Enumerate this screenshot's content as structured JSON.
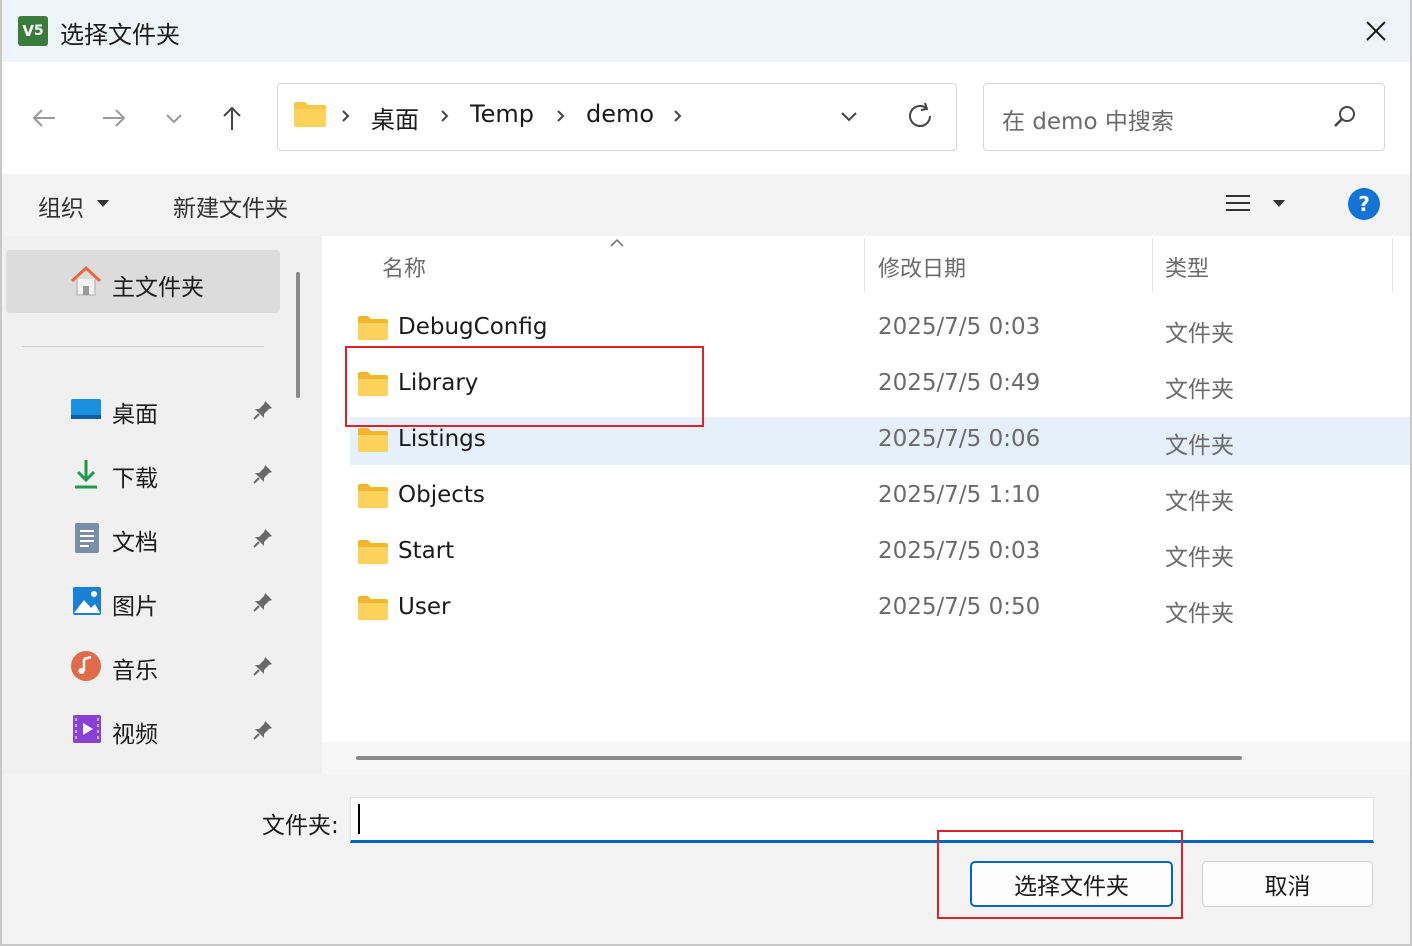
{
  "window": {
    "title": "选择文件夹",
    "app_icon_letter": "V",
    "app_icon_sub": "5"
  },
  "breadcrumb": [
    "桌面",
    "Temp",
    "demo"
  ],
  "search": {
    "placeholder": "在 demo 中搜索"
  },
  "toolbar": {
    "organize": "组织",
    "new_folder": "新建文件夹"
  },
  "sidebar": {
    "home": "主文件夹",
    "items": [
      {
        "label": "桌面",
        "icon": "desktop-icon"
      },
      {
        "label": "下载",
        "icon": "download-icon"
      },
      {
        "label": "文档",
        "icon": "document-icon"
      },
      {
        "label": "图片",
        "icon": "picture-icon"
      },
      {
        "label": "音乐",
        "icon": "music-icon"
      },
      {
        "label": "视频",
        "icon": "video-icon"
      }
    ]
  },
  "columns": {
    "name": "名称",
    "date": "修改日期",
    "type": "类型"
  },
  "files": [
    {
      "name": "DebugConfig",
      "date": "2025/7/5 0:03",
      "type": "文件夹"
    },
    {
      "name": "Library",
      "date": "2025/7/5 0:49",
      "type": "文件夹"
    },
    {
      "name": "Listings",
      "date": "2025/7/5 0:06",
      "type": "文件夹"
    },
    {
      "name": "Objects",
      "date": "2025/7/5 1:10",
      "type": "文件夹"
    },
    {
      "name": "Start",
      "date": "2025/7/5 0:03",
      "type": "文件夹"
    },
    {
      "name": "User",
      "date": "2025/7/5 0:50",
      "type": "文件夹"
    }
  ],
  "footer": {
    "folder_label": "文件夹:",
    "folder_value": "",
    "select_button": "选择文件夹",
    "cancel_button": "取消"
  },
  "colors": {
    "accent": "#0067c0",
    "highlight": "#e0202a",
    "selected_row": "#e6f0fa",
    "folder": "#f7c844"
  }
}
